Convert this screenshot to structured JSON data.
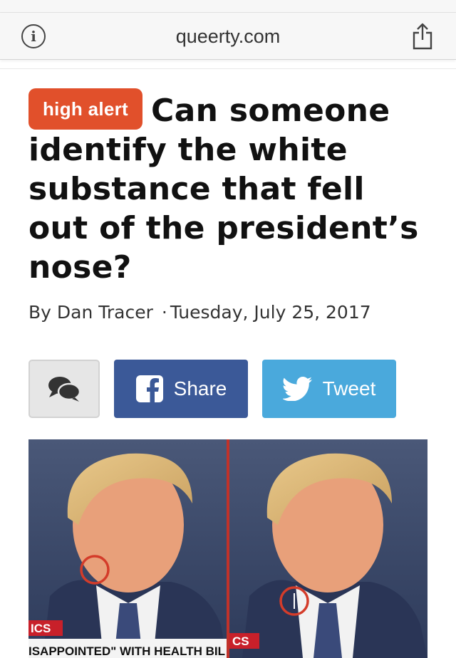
{
  "browser": {
    "url": "queerty.com",
    "icons": {
      "info": "info-icon",
      "share": "share-icon"
    }
  },
  "article": {
    "badge": "high alert",
    "title": "Can someone identify the white substance that fell out of the president’s nose?",
    "author": "By Dan Tracer",
    "separator": "·",
    "date": "Tuesday, July 25, 2017"
  },
  "share_bar": {
    "comment_icon": "comment-bubbles-icon",
    "facebook_label": "Share",
    "twitter_label": "Tweet"
  },
  "image": {
    "left_caption_tag": "ICS",
    "right_caption_tag": "CS",
    "caption_ticker": "ISAPPOINTED\" WITH HEALTH BIL",
    "colors": {
      "highlight": "#d43c2a",
      "divider": "#c0322a"
    }
  },
  "colors": {
    "badge": "#e1502b",
    "facebook": "#3b5998",
    "twitter": "#4aa9dc"
  }
}
